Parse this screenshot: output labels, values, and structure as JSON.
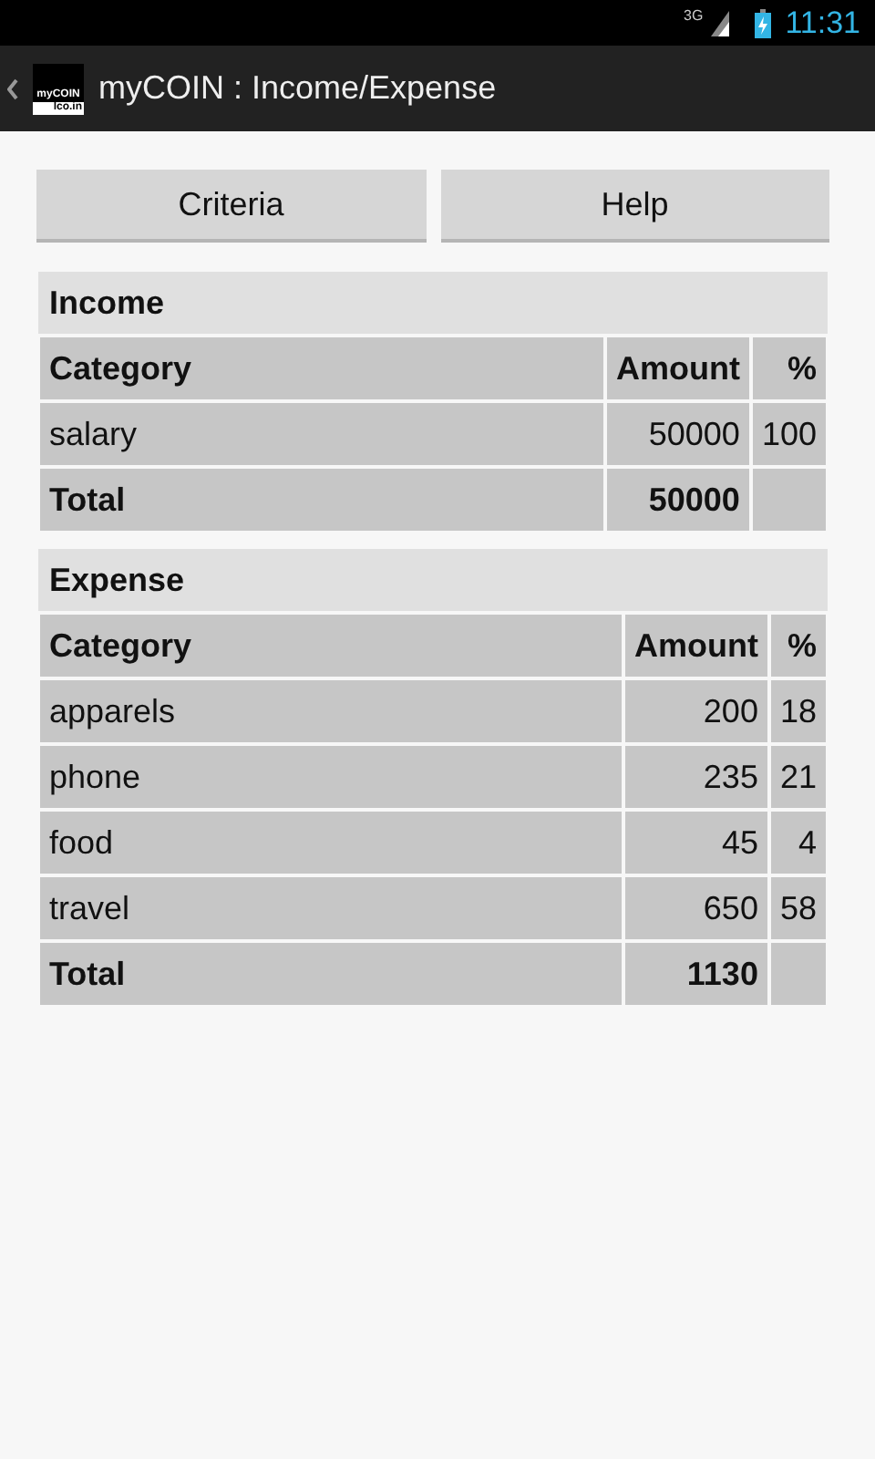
{
  "status_bar": {
    "network": "3G",
    "time": "11:31"
  },
  "action_bar": {
    "logo_lines": [
      "myCOIN",
      "lco.in"
    ],
    "title": "myCOIN : Income/Expense"
  },
  "buttons": [
    "Criteria",
    "Help"
  ],
  "sections": [
    {
      "title": "Income",
      "columns": [
        "Category",
        "Amount",
        "%"
      ],
      "rows": [
        {
          "kind": "item",
          "cells": [
            "salary",
            "50000",
            "100"
          ]
        },
        {
          "kind": "total",
          "cells": [
            "Total",
            "50000",
            ""
          ]
        }
      ]
    },
    {
      "title": "Expense",
      "columns": [
        "Category",
        "Amount",
        "%"
      ],
      "rows": [
        {
          "kind": "item",
          "cells": [
            "apparels",
            "200",
            "18"
          ]
        },
        {
          "kind": "item",
          "cells": [
            "phone",
            "235",
            "21"
          ]
        },
        {
          "kind": "item",
          "cells": [
            "food",
            "45",
            "4"
          ]
        },
        {
          "kind": "item",
          "cells": [
            "travel",
            "650",
            "58"
          ]
        },
        {
          "kind": "total",
          "cells": [
            "Total",
            "1130",
            ""
          ]
        }
      ]
    }
  ]
}
